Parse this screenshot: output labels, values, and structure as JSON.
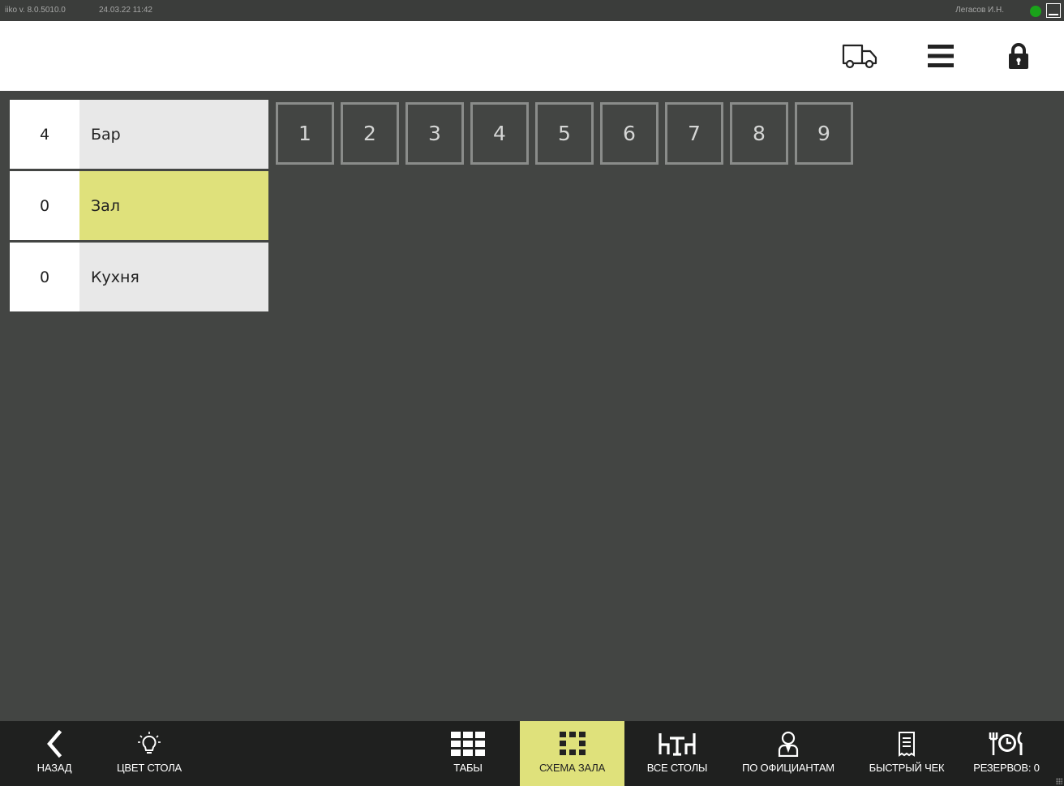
{
  "titlebar": {
    "version": "iiko v. 8.0.5010.0",
    "datetime": "24.03.22  11:42",
    "user": "Легасов И.Н."
  },
  "header": {
    "icons": [
      "delivery-truck-icon",
      "hamburger-menu-icon",
      "lock-icon"
    ]
  },
  "sections": [
    {
      "count": "4",
      "name": "Бар",
      "active": false
    },
    {
      "count": "0",
      "name": "Зал",
      "active": true
    },
    {
      "count": "0",
      "name": "Кухня",
      "active": false
    }
  ],
  "tables": [
    "1",
    "2",
    "3",
    "4",
    "5",
    "6",
    "7",
    "8",
    "9"
  ],
  "bottombar": {
    "back": "НАЗАД",
    "table_color": "ЦВЕТ СТОЛА",
    "tabs": "ТАБЫ",
    "hall_scheme": "СХЕМА ЗАЛА",
    "all_tables": "ВСЕ СТОЛЫ",
    "by_waiters": "ПО ОФИЦИАНТАМ",
    "quick_check": "БЫСТРЫЙ ЧЕК",
    "reservations": "РЕЗЕРВОВ: 0"
  },
  "colors": {
    "accent": "#dfe17b",
    "main_bg": "#434543",
    "bar_bg": "#1f201f",
    "status_online": "#1aa31a"
  }
}
